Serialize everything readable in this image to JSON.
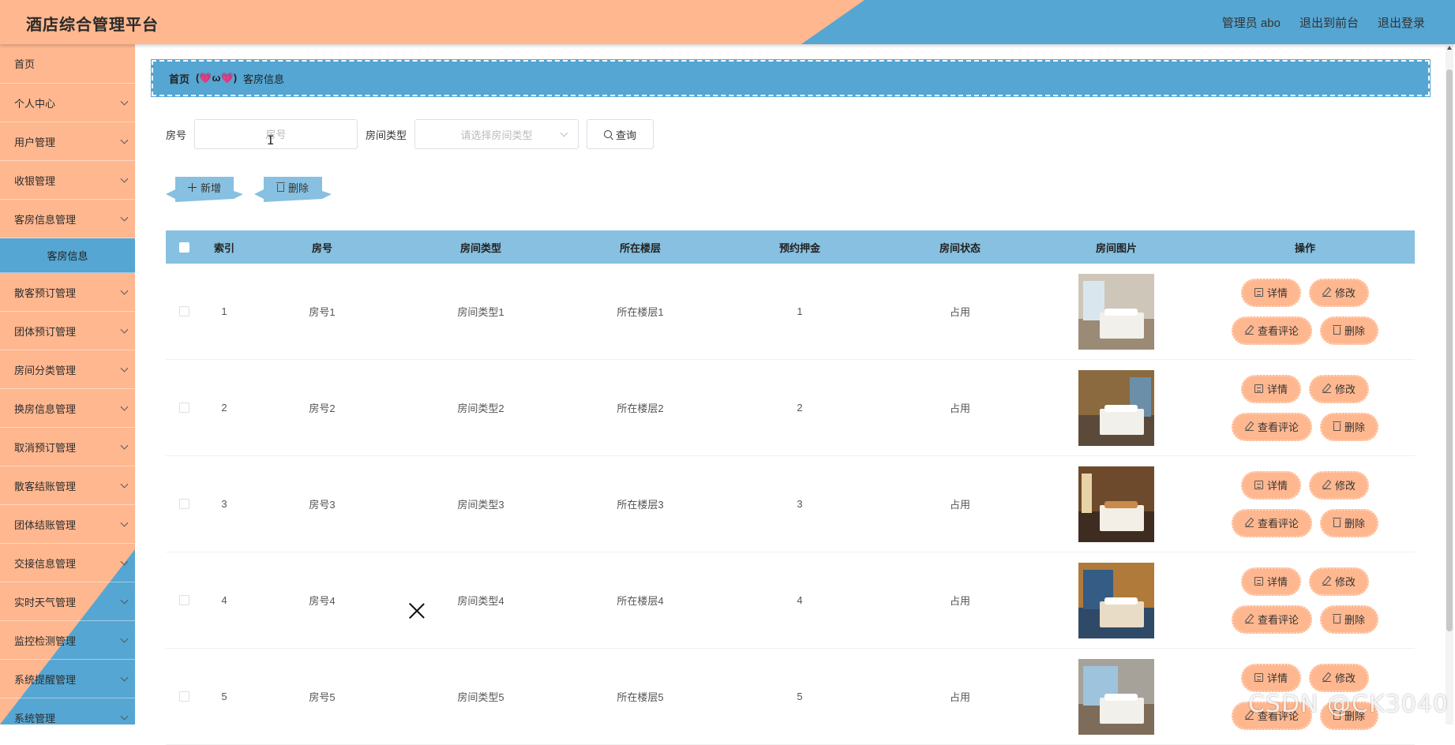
{
  "header": {
    "title": "酒店综合管理平台",
    "admin": "管理员 abo",
    "back_front": "退出到前台",
    "logout": "退出登录"
  },
  "sidebar": {
    "home": "首页",
    "groups": [
      {
        "label": "个人中心"
      },
      {
        "label": "用户管理"
      },
      {
        "label": "收银管理"
      },
      {
        "label": "客房信息管理"
      }
    ],
    "active_sub": "客房信息",
    "groups_after": [
      {
        "label": "散客预订管理"
      },
      {
        "label": "团体预订管理"
      },
      {
        "label": "房间分类管理"
      },
      {
        "label": "换房信息管理"
      },
      {
        "label": "取消预订管理"
      },
      {
        "label": "散客结账管理"
      },
      {
        "label": "团体结账管理"
      },
      {
        "label": "交接信息管理"
      },
      {
        "label": "实时天气管理"
      },
      {
        "label": "监控检测管理"
      },
      {
        "label": "系统提醒管理"
      },
      {
        "label": "系统管理"
      }
    ]
  },
  "breadcrumb": {
    "home": "首页",
    "sep": "(💗ω💗)",
    "current": "客房信息"
  },
  "search": {
    "room_no_label": "房号",
    "room_no_placeholder": "房号",
    "room_type_label": "房间类型",
    "room_type_placeholder": "请选择房间类型",
    "query_label": "查询"
  },
  "actions": {
    "add_label": "新增",
    "delete_label": "删除"
  },
  "table": {
    "headers": [
      "索引",
      "房号",
      "房间类型",
      "所在楼层",
      "预约押金",
      "房间状态",
      "房间图片",
      "操作"
    ],
    "ops": {
      "detail": "详情",
      "edit": "修改",
      "review": "查看评论",
      "delete": "删除"
    },
    "rows": [
      {
        "index": "1",
        "room_no": "房号1",
        "room_type": "房间类型1",
        "floor": "所在楼层1",
        "deposit": "1",
        "status": "占用"
      },
      {
        "index": "2",
        "room_no": "房号2",
        "room_type": "房间类型2",
        "floor": "所在楼层2",
        "deposit": "2",
        "status": "占用"
      },
      {
        "index": "3",
        "room_no": "房号3",
        "room_type": "房间类型3",
        "floor": "所在楼层3",
        "deposit": "3",
        "status": "占用"
      },
      {
        "index": "4",
        "room_no": "房号4",
        "room_type": "房间类型4",
        "floor": "所在楼层4",
        "deposit": "4",
        "status": "占用"
      },
      {
        "index": "5",
        "room_no": "房号5",
        "room_type": "房间类型5",
        "floor": "所在楼层5",
        "deposit": "5",
        "status": "占用"
      }
    ]
  },
  "watermark": "CSDN @CK3040",
  "colors": {
    "peach": "#ffb78f",
    "blue": "#55a6d3",
    "header_row": "#87c0e0"
  }
}
